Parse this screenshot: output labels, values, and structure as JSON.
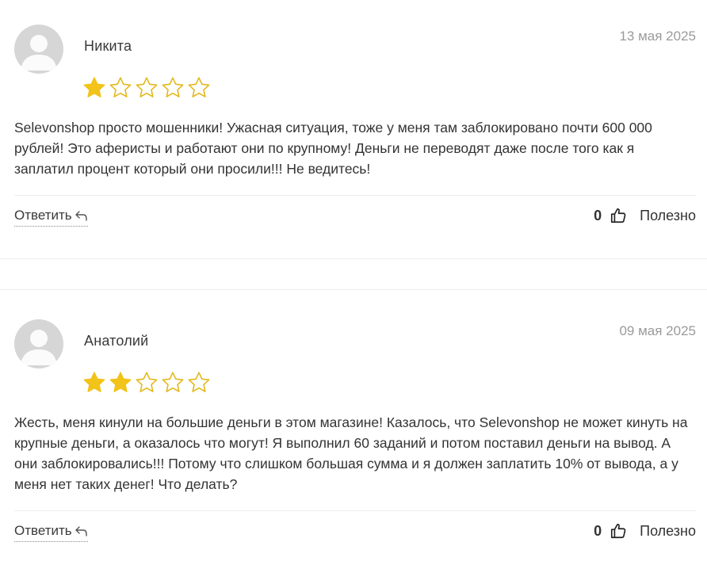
{
  "reviews": [
    {
      "author": "Никита",
      "date": "13 мая 2025",
      "rating": 1,
      "max_rating": 5,
      "text": "Selevonshop просто мошенники! Ужасная ситуация, тоже у меня там заблокировано почти 600 000 рублей! Это аферисты и работают они по крупному! Деньги не переводят даже после того как я заплатил процент который они просили!!! Не ведитесь!",
      "reply_label": "Ответить",
      "helpful_count": "0",
      "helpful_label": "Полезно"
    },
    {
      "author": "Анатолий",
      "date": "09 мая 2025",
      "rating": 2,
      "max_rating": 5,
      "text": "Жесть, меня кинули на большие деньги в этом магазине! Казалось, что Selevonshop не может кинуть на крупные деньги, а оказалось что могут! Я выполнил 60 заданий и потом поставил деньги на вывод. А они заблокировались!!! Потому что слишком большая сумма и я должен заплатить 10% от вывода, а у меня нет таких денег! Что делать?",
      "reply_label": "Ответить",
      "helpful_count": "0",
      "helpful_label": "Полезно"
    }
  ],
  "colors": {
    "star_filled": "#f2c318",
    "star_outline": "#e3b81a",
    "date": "#9a9a9a",
    "avatar_bg": "#d6d6d6",
    "avatar_fg": "#ffffff"
  },
  "icons": {
    "avatar": "user-silhouette-icon",
    "star": "star-icon",
    "reply": "reply-arrow-icon",
    "helpful": "thumbs-up-icon"
  }
}
